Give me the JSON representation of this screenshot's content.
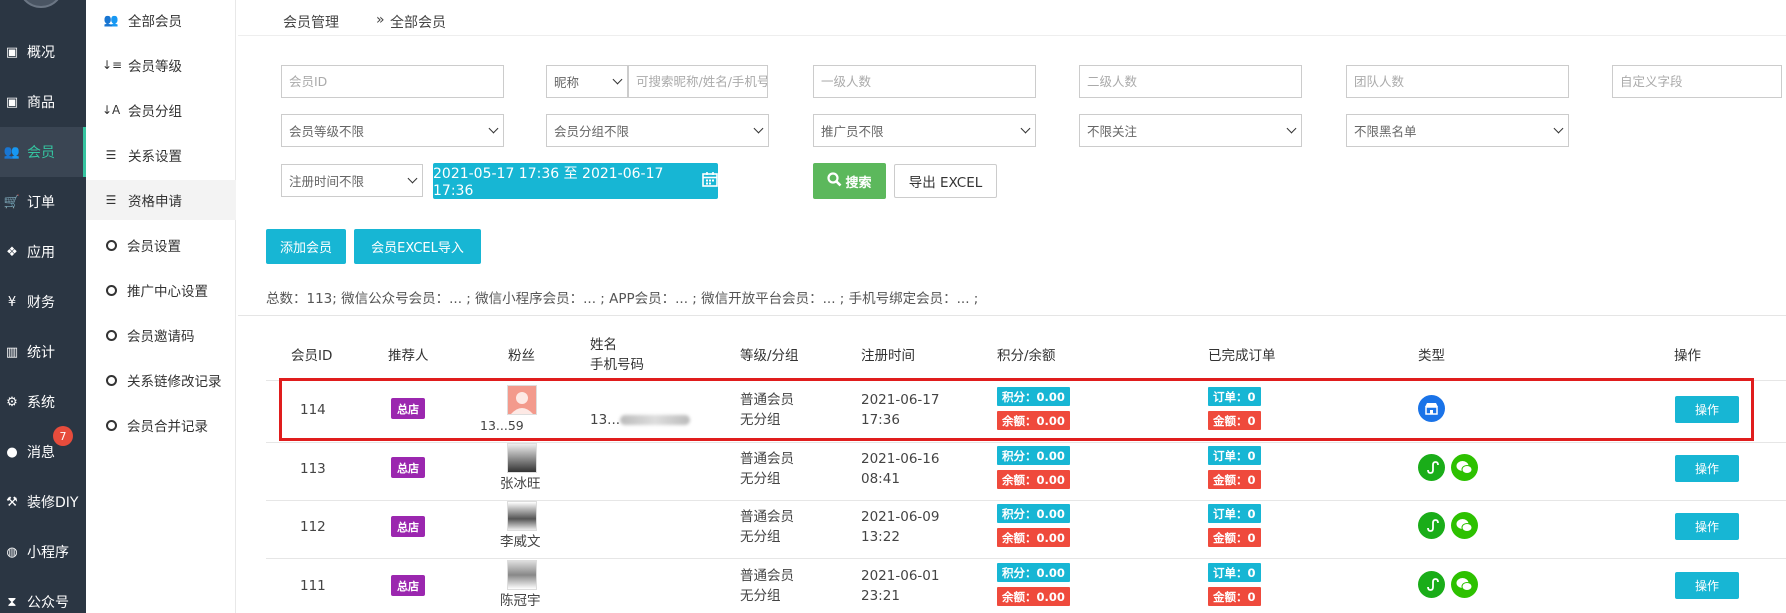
{
  "sidebar": {
    "items": [
      {
        "label": "概况",
        "icon": "dashboard-icon",
        "glyph": "▣"
      },
      {
        "label": "商品",
        "icon": "goods-icon",
        "glyph": "▣"
      },
      {
        "label": "会员",
        "icon": "members-icon",
        "glyph": "👥"
      },
      {
        "label": "订单",
        "icon": "cart-icon",
        "glyph": "🛒"
      },
      {
        "label": "应用",
        "icon": "apps-icon",
        "glyph": "❖"
      },
      {
        "label": "财务",
        "icon": "yen-icon",
        "glyph": "¥"
      },
      {
        "label": "统计",
        "icon": "stats-icon",
        "glyph": "▥"
      },
      {
        "label": "系统",
        "icon": "gear-icon",
        "glyph": "⚙"
      },
      {
        "label": "消息",
        "icon": "message-icon",
        "glyph": "●"
      },
      {
        "label": "装修DIY",
        "icon": "hammer-icon",
        "glyph": "⚒"
      },
      {
        "label": "小程序",
        "icon": "miniapp-icon",
        "glyph": "◍"
      },
      {
        "label": "公众号",
        "icon": "hourglass-icon",
        "glyph": "⧗"
      }
    ],
    "message_badge": "7"
  },
  "submenu": {
    "items": [
      {
        "label": "全部会员",
        "glyph": "👥"
      },
      {
        "label": "会员等级",
        "glyph": "↓≡"
      },
      {
        "label": "会员分组",
        "glyph": "↓A"
      },
      {
        "label": "关系设置",
        "glyph": "☰"
      },
      {
        "label": "资格申请",
        "glyph": "☰"
      },
      {
        "label": "会员设置"
      },
      {
        "label": "推广中心设置"
      },
      {
        "label": "会员邀请码"
      },
      {
        "label": "关系链修改记录"
      },
      {
        "label": "会员合并记录"
      }
    ]
  },
  "breadcrumb": {
    "root": "会员管理",
    "sep": "»",
    "current": "全部会员"
  },
  "filters": {
    "member_id_ph": "会员ID",
    "nickname_select": "昵称",
    "search_ph": "可搜索昵称/姓名/手机号",
    "level1_ph": "一级人数",
    "level2_ph": "二级人数",
    "team_ph": "团队人数",
    "custom_ph": "自定义字段",
    "level_select": "会员等级不限",
    "group_select": "会员分组不限",
    "promoter_select": "推广员不限",
    "follow_select": "不限关注",
    "blacklist_select": "不限黑名单",
    "regtime_select": "注册时间不限",
    "date_range": "2021-05-17 17:36 至 2021-06-17 17:36",
    "search_btn": "搜索",
    "export_btn": "导出 EXCEL"
  },
  "actions": {
    "add": "添加会员",
    "import": "会员EXCEL导入"
  },
  "summary": "总数：113; 微信公众号会员：... ;   微信小程序会员：... ;   APP会员：... ;   微信开放平台会员：... ;   手机号绑定会员：... ;",
  "table": {
    "headers": {
      "id": "会员ID",
      "ref": "推荐人",
      "fans": "粉丝",
      "name": "姓名",
      "phone": "手机号码",
      "level": "等级/分组",
      "reg": "注册时间",
      "points": "积分/余额",
      "orders": "已完成订单",
      "type": "类型",
      "op": "操作"
    },
    "rows": [
      {
        "id": "114",
        "ref": "总店",
        "fan_name": "13...59",
        "phone": "13...",
        "level": "普通会员",
        "group": "无分组",
        "date": "2021-06-17",
        "time": "17:36",
        "points": "积分：0.00",
        "balance": "余额：0.00",
        "orders": "订单：0",
        "amount": "金额：0",
        "op": "操作"
      },
      {
        "id": "113",
        "ref": "总店",
        "fan_name": "张冰旺",
        "phone": "",
        "level": "普通会员",
        "group": "无分组",
        "date": "2021-06-16",
        "time": "08:41",
        "points": "积分：0.00",
        "balance": "余额：0.00",
        "orders": "订单：0",
        "amount": "金额：0",
        "op": "操作"
      },
      {
        "id": "112",
        "ref": "总店",
        "fan_name": "李威文",
        "phone": "",
        "level": "普通会员",
        "group": "无分组",
        "date": "2021-06-09",
        "time": "13:22",
        "points": "积分：0.00",
        "balance": "余额：0.00",
        "orders": "订单：0",
        "amount": "金额：0",
        "op": "操作"
      },
      {
        "id": "111",
        "ref": "总店",
        "fan_name": "陈冠宇",
        "phone": "",
        "level": "普通会员",
        "group": "无分组",
        "date": "2021-06-01",
        "time": "23:21",
        "points": "积分：0.00",
        "balance": "余额：0.00",
        "orders": "订单：0",
        "amount": "金额：0",
        "op": "操作"
      }
    ]
  },
  "colors": {
    "accent": "#17b6d4",
    "sidebar": "#2b3643",
    "active": "#35c4a0",
    "danger": "#ef4a3c",
    "highlight": "#e01d1d"
  }
}
